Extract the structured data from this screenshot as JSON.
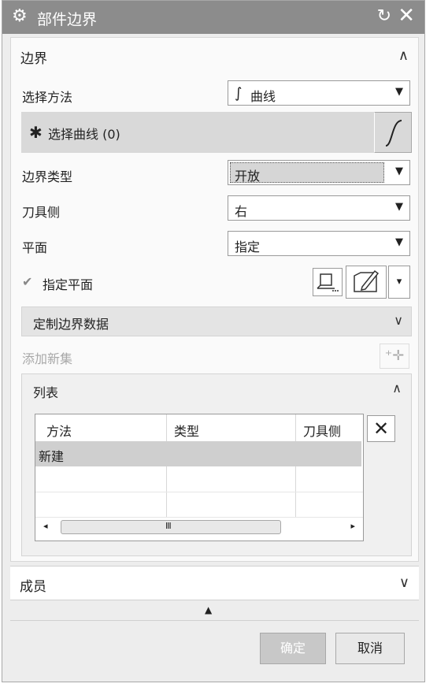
{
  "window": {
    "title": "部件边界",
    "icons": [
      "gear-icon",
      "reset-icon",
      "close-icon"
    ]
  },
  "boundary_section": {
    "title": "边界",
    "select_method": {
      "label": "选择方法",
      "value": "曲线"
    },
    "select_curve": {
      "label": "选择曲线 (0)"
    },
    "boundary_type": {
      "label": "边界类型",
      "value": "开放"
    },
    "tool_side": {
      "label": "刀具侧",
      "value": "右"
    },
    "plane": {
      "label": "平面",
      "value": "指定"
    },
    "specify_plane": {
      "label": "指定平面"
    },
    "custom_boundary_data": {
      "label": "定制边界数据"
    },
    "add_new_set": {
      "label": "添加新集"
    },
    "list": {
      "title": "列表",
      "columns": [
        "方法",
        "类型",
        "刀具侧"
      ],
      "rows": [
        [
          "新建",
          "",
          ""
        ]
      ],
      "scroll_mark": "III"
    }
  },
  "members_section": {
    "title": "成员"
  },
  "buttons": {
    "ok": "确定",
    "cancel": "取消"
  }
}
